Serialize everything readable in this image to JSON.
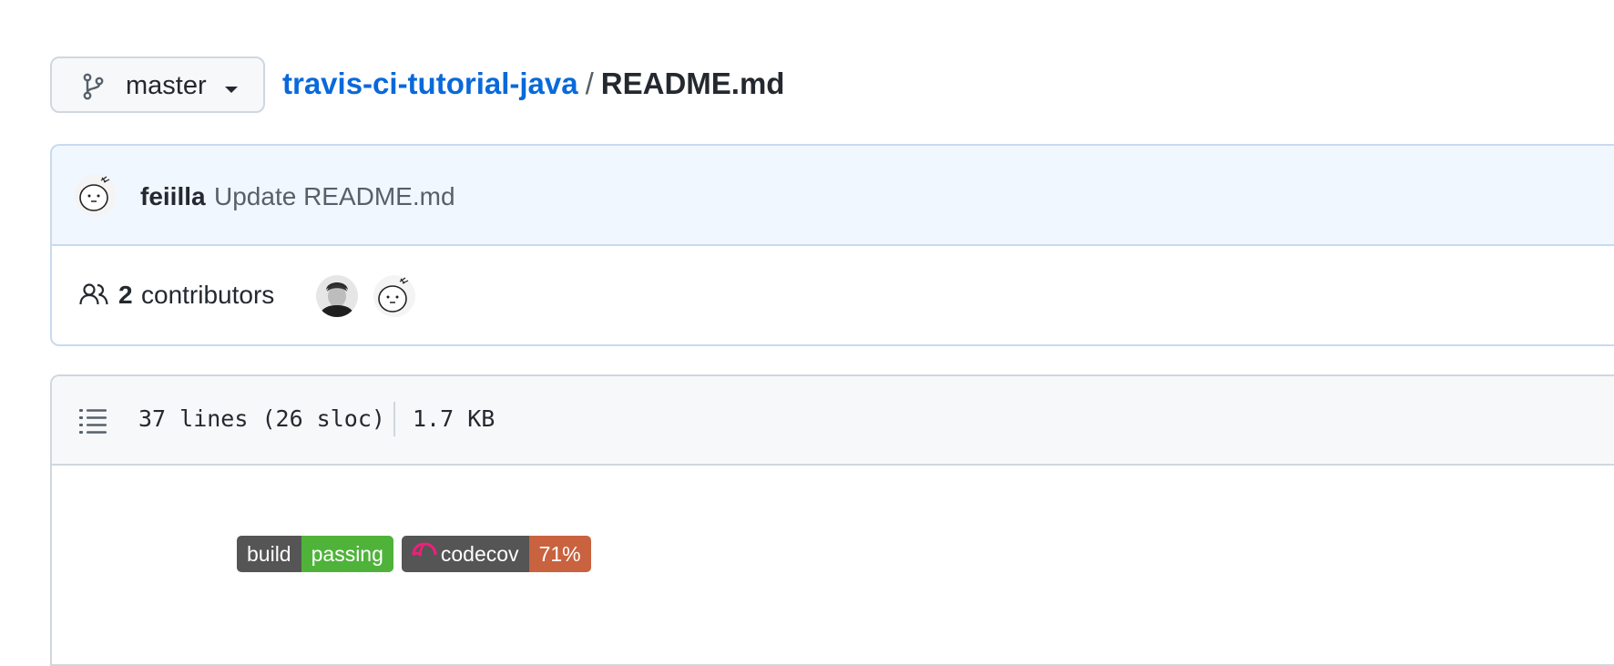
{
  "branch": {
    "name": "master"
  },
  "breadcrumb": {
    "repo": "travis-ci-tutorial-java",
    "separator": "/",
    "file": "README.md"
  },
  "commit": {
    "author": "feiilla",
    "message": "Update README.md"
  },
  "contributors": {
    "count": "2",
    "label": "contributors"
  },
  "file_info": {
    "lines": "37 lines (26 sloc)",
    "size": "1.7 KB"
  },
  "badges": [
    {
      "left": "build",
      "right": "passing",
      "right_color": "#4c1"
    },
    {
      "left": "codecov",
      "right": "71%",
      "right_color": "#e05d44"
    }
  ],
  "colors": {
    "link": "#0969da",
    "commit_bg": "#f1f7fe",
    "border": "#d0d7de",
    "codecov_pink": "#f01f7a"
  }
}
